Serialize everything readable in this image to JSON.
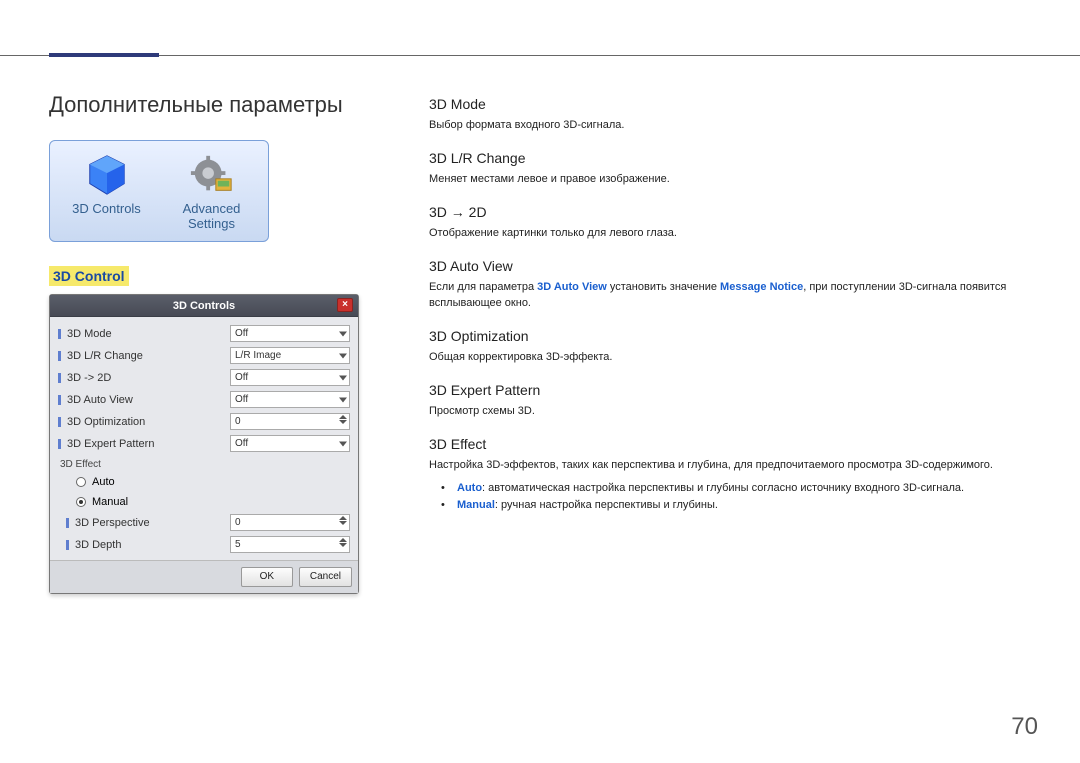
{
  "pageNumber": "70",
  "left": {
    "title": "Дополнительные параметры",
    "tiles": {
      "controls": "3D Controls",
      "advanced_l1": "Advanced",
      "advanced_l2": "Settings"
    },
    "subsection": "3D Control"
  },
  "dialog": {
    "title": "3D Controls",
    "rows": [
      {
        "label": "3D Mode",
        "value": "Off",
        "type": "dropdown"
      },
      {
        "label": "3D L/R Change",
        "value": "L/R Image",
        "type": "dropdown"
      },
      {
        "label": "3D -> 2D",
        "value": "Off",
        "type": "dropdown"
      },
      {
        "label": "3D Auto View",
        "value": "Off",
        "type": "dropdown"
      },
      {
        "label": "3D Optimization",
        "value": "0",
        "type": "spinner"
      },
      {
        "label": "3D Expert Pattern",
        "value": "Off",
        "type": "dropdown"
      }
    ],
    "effectSection": "3D Effect",
    "radios": {
      "auto": "Auto",
      "manual": "Manual",
      "selected": "manual"
    },
    "subRows": [
      {
        "label": "3D Perspective",
        "value": "0"
      },
      {
        "label": "3D Depth",
        "value": "5"
      }
    ],
    "buttons": {
      "ok": "OK",
      "cancel": "Cancel"
    }
  },
  "right": {
    "s1": {
      "h": "3D Mode",
      "p": "Выбор формата входного 3D-сигнала."
    },
    "s2": {
      "h": "3D L/R Change",
      "p": "Меняет местами левое и правое изображение."
    },
    "s3": {
      "h": "3D → 2D",
      "p": "Отображение картинки только для левого глаза."
    },
    "s4": {
      "h": "3D Auto View",
      "p1": "Если для параметра ",
      "b1": "3D Auto View",
      "p2": " установить значение ",
      "b2": "Message Notice",
      "p3": ", при поступлении 3D-сигнала появится всплывающее окно."
    },
    "s5": {
      "h": "3D Optimization",
      "p": "Общая корректировка 3D-эффекта."
    },
    "s6": {
      "h": "3D Expert Pattern",
      "p": "Просмотр схемы 3D."
    },
    "s7": {
      "h": "3D Effect",
      "p": "Настройка 3D-эффектов, таких как перспектива и глубина, для предпочитаемого просмотра 3D-содержимого.",
      "bullet1_b": "Auto",
      "bullet1_t": ": автоматическая настройка перспективы и глубины согласно источнику входного 3D-сигнала.",
      "bullet2_b": "Manual",
      "bullet2_t": ": ручная настройка перспективы и глубины."
    }
  }
}
